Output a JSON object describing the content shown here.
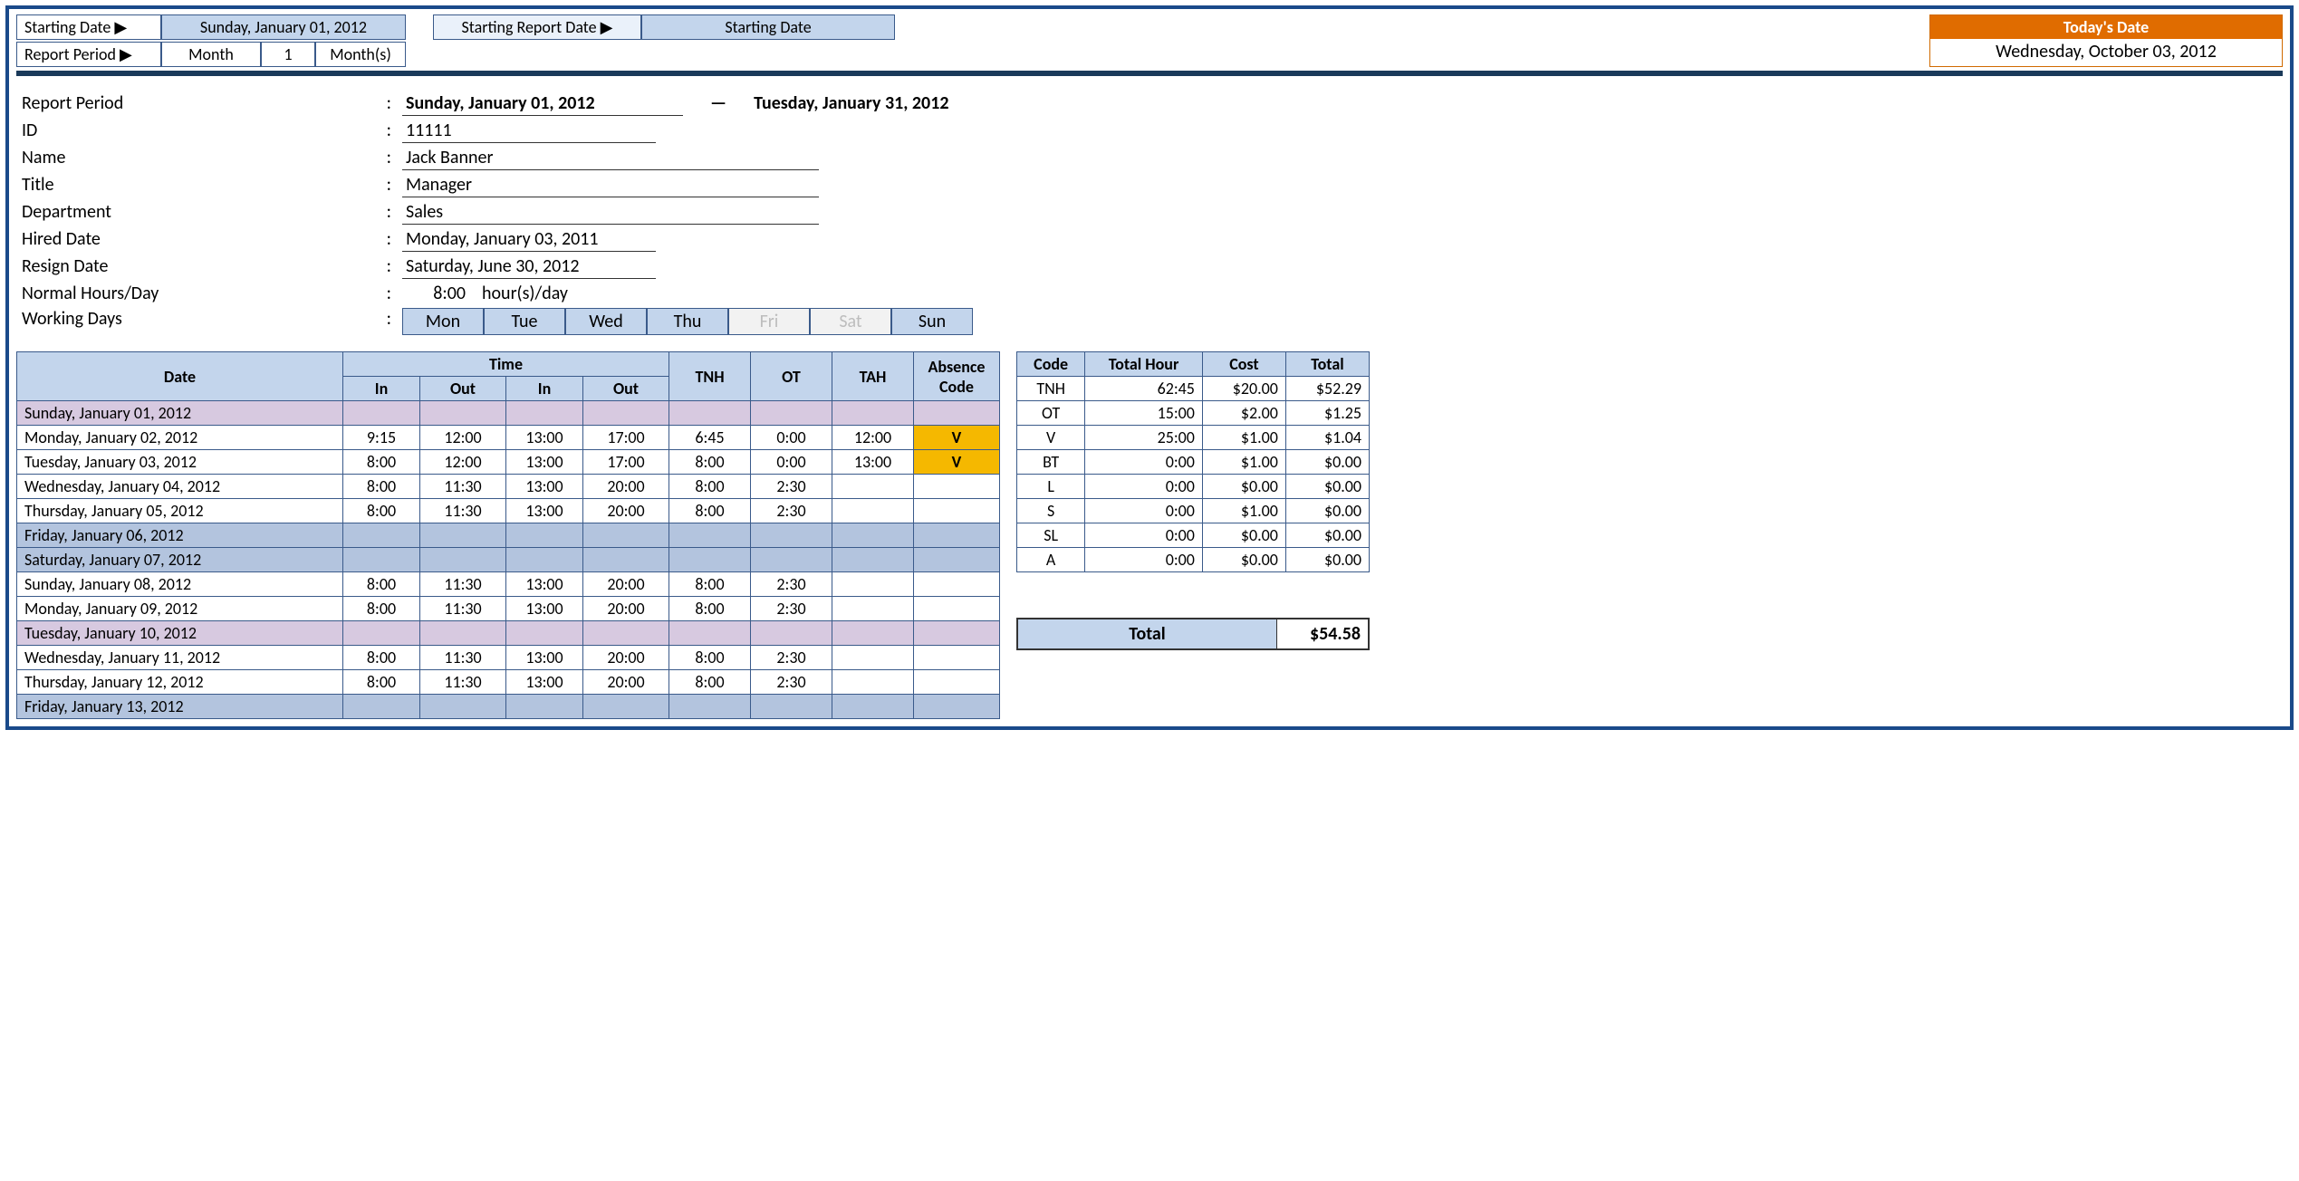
{
  "top": {
    "starting_date_label": "Starting Date ▶",
    "starting_date_value": "Sunday, January 01, 2012",
    "starting_report_label": "Starting Report Date ▶",
    "starting_report_value": "Starting Date",
    "report_period_label": "Report Period ▶",
    "report_period_unit": "Month",
    "report_period_count": "1",
    "report_period_suffix": "Month(s)",
    "today_label": "Today's Date",
    "today_value": "Wednesday, October 03, 2012"
  },
  "info": {
    "report_period_label": "Report Period",
    "report_start": "Sunday, January 01, 2012",
    "report_dash": "—",
    "report_end": "Tuesday, January 31, 2012",
    "id_label": "ID",
    "id_value": "11111",
    "name_label": "Name",
    "name_value": "Jack Banner",
    "title_label": "Title",
    "title_value": "Manager",
    "dept_label": "Department",
    "dept_value": "Sales",
    "hired_label": "Hired Date",
    "hired_value": "Monday, January 03, 2011",
    "resign_label": "Resign Date",
    "resign_value": "Saturday, June 30, 2012",
    "hours_label": "Normal Hours/Day",
    "hours_value": "8:00",
    "hours_unit": "hour(s)/day",
    "days_label": "Working Days",
    "days": [
      {
        "name": "Mon",
        "on": true
      },
      {
        "name": "Tue",
        "on": true
      },
      {
        "name": "Wed",
        "on": true
      },
      {
        "name": "Thu",
        "on": true
      },
      {
        "name": "Fri",
        "on": false
      },
      {
        "name": "Sat",
        "on": false
      },
      {
        "name": "Sun",
        "on": true
      }
    ]
  },
  "time_headers": {
    "date": "Date",
    "time": "Time",
    "in": "In",
    "out": "Out",
    "tnh": "TNH",
    "ot": "OT",
    "tah": "TAH",
    "absence": "Absence Code"
  },
  "rows": [
    {
      "date": "Sunday, January 01, 2012",
      "class": "row-purple"
    },
    {
      "date": "Monday, January 02, 2012",
      "in1": "9:15",
      "out1": "12:00",
      "in2": "13:00",
      "out2": "17:00",
      "tnh": "6:45",
      "ot": "0:00",
      "tah": "12:00",
      "abs": "V"
    },
    {
      "date": "Tuesday, January 03, 2012",
      "in1": "8:00",
      "out1": "12:00",
      "in2": "13:00",
      "out2": "17:00",
      "tnh": "8:00",
      "ot": "0:00",
      "tah": "13:00",
      "abs": "V"
    },
    {
      "date": "Wednesday, January 04, 2012",
      "in1": "8:00",
      "out1": "11:30",
      "in2": "13:00",
      "out2": "20:00",
      "tnh": "8:00",
      "ot": "2:30"
    },
    {
      "date": "Thursday, January 05, 2012",
      "in1": "8:00",
      "out1": "11:30",
      "in2": "13:00",
      "out2": "20:00",
      "tnh": "8:00",
      "ot": "2:30"
    },
    {
      "date": "Friday, January 06, 2012",
      "class": "row-blue"
    },
    {
      "date": "Saturday, January 07, 2012",
      "class": "row-blue"
    },
    {
      "date": "Sunday, January 08, 2012",
      "in1": "8:00",
      "out1": "11:30",
      "in2": "13:00",
      "out2": "20:00",
      "tnh": "8:00",
      "ot": "2:30"
    },
    {
      "date": "Monday, January 09, 2012",
      "in1": "8:00",
      "out1": "11:30",
      "in2": "13:00",
      "out2": "20:00",
      "tnh": "8:00",
      "ot": "2:30"
    },
    {
      "date": "Tuesday, January 10, 2012",
      "class": "row-purple"
    },
    {
      "date": "Wednesday, January 11, 2012",
      "in1": "8:00",
      "out1": "11:30",
      "in2": "13:00",
      "out2": "20:00",
      "tnh": "8:00",
      "ot": "2:30"
    },
    {
      "date": "Thursday, January 12, 2012",
      "in1": "8:00",
      "out1": "11:30",
      "in2": "13:00",
      "out2": "20:00",
      "tnh": "8:00",
      "ot": "2:30"
    },
    {
      "date": "Friday, January 13, 2012",
      "class": "row-blue"
    }
  ],
  "summary_headers": {
    "code": "Code",
    "hour": "Total Hour",
    "cost": "Cost",
    "total": "Total"
  },
  "summary": [
    {
      "code": "TNH",
      "hour": "62:45",
      "cost": "$20.00",
      "total": "$52.29"
    },
    {
      "code": "OT",
      "hour": "15:00",
      "cost": "$2.00",
      "total": "$1.25"
    },
    {
      "code": "V",
      "hour": "25:00",
      "cost": "$1.00",
      "total": "$1.04"
    },
    {
      "code": "BT",
      "hour": "0:00",
      "cost": "$1.00",
      "total": "$0.00"
    },
    {
      "code": "L",
      "hour": "0:00",
      "cost": "$0.00",
      "total": "$0.00"
    },
    {
      "code": "S",
      "hour": "0:00",
      "cost": "$1.00",
      "total": "$0.00"
    },
    {
      "code": "SL",
      "hour": "0:00",
      "cost": "$0.00",
      "total": "$0.00"
    },
    {
      "code": "A",
      "hour": "0:00",
      "cost": "$0.00",
      "total": "$0.00"
    }
  ],
  "grand_total": {
    "label": "Total",
    "value": "$54.58"
  }
}
